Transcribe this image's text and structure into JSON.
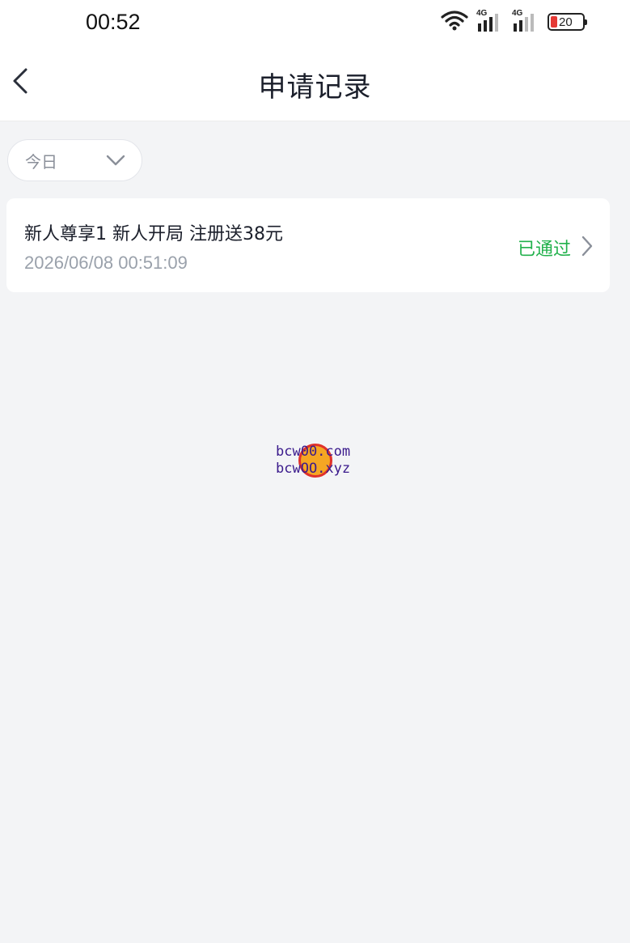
{
  "status_bar": {
    "time": "00:52",
    "signal_1": "4G",
    "signal_2": "4G",
    "battery": "20",
    "icons": [
      "wifi-icon",
      "signal-4g-icon",
      "signal-4g-icon",
      "battery-icon"
    ]
  },
  "header": {
    "title": "申请记录",
    "back_icon": "chevron-left-icon"
  },
  "filter": {
    "selected": "今日",
    "icon": "chevron-down-icon"
  },
  "records": [
    {
      "title": "新人尊享1  新人开局 注册送38元",
      "time": "2026/06/08 00:51:09",
      "status": "已通过",
      "status_color": "#22b14c"
    }
  ],
  "watermark": {
    "line1": "bcw00.com",
    "line2": "bcwOO.xyz"
  },
  "colors": {
    "background": "#f3f4f6",
    "surface": "#ffffff",
    "text_primary": "#1b1f2b",
    "text_secondary": "#9aa1ab",
    "success": "#22b14c"
  }
}
